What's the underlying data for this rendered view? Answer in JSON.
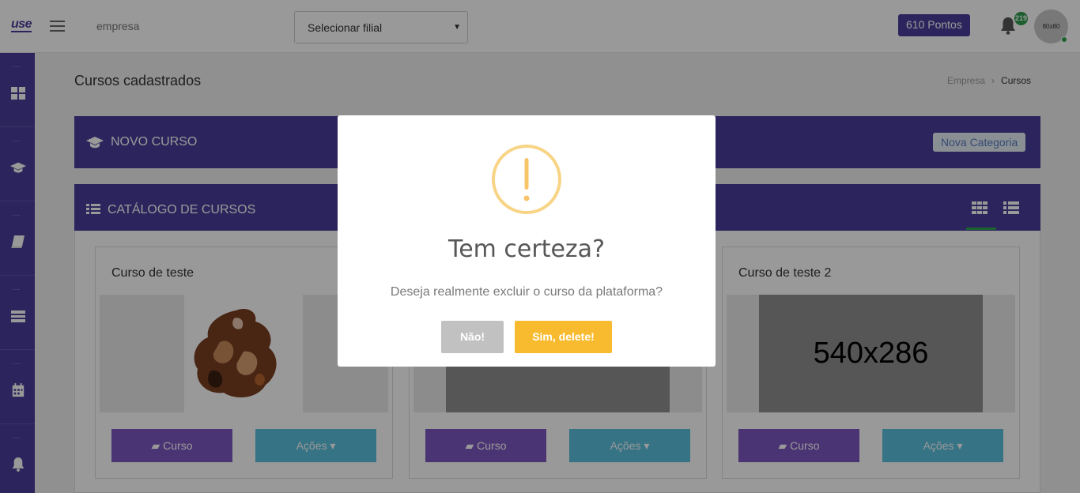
{
  "header": {
    "logo": "use",
    "company": "empresa",
    "branch_select": "Selecionar filial",
    "points": "610 Pontos",
    "notification_count": "219",
    "avatar_label": "80x80"
  },
  "sidebar": {
    "items": [
      {
        "dots": "...",
        "icon": "dashboard-icon"
      },
      {
        "dots": "...",
        "icon": "graduation-cap-icon"
      },
      {
        "dots": "...",
        "icon": "book-icon"
      },
      {
        "dots": "...",
        "icon": "tasks-icon"
      },
      {
        "dots": "...",
        "icon": "calendar-icon"
      },
      {
        "dots": "...",
        "icon": "bell-icon"
      }
    ]
  },
  "page": {
    "title": "Cursos cadastrados",
    "breadcrumb": [
      "Empresa",
      "Cursos"
    ]
  },
  "panels": {
    "new_course": "NOVO CURSO",
    "new_category": "Nova Categoria",
    "catalog": "CATÁLOGO DE CURSOS"
  },
  "cards": [
    {
      "title": "Curso de teste",
      "curso_label": "Curso",
      "acoes_label": "Ações"
    },
    {
      "title": "",
      "curso_label": "Curso",
      "acoes_label": "Ações"
    },
    {
      "title": "Curso de teste 2",
      "image_placeholder": "540x286",
      "curso_label": "Curso",
      "acoes_label": "Ações"
    }
  ],
  "modal": {
    "title": "Tem certeza?",
    "text": "Deseja realmente excluir o curso da plataforma?",
    "cancel": "Não!",
    "confirm": "Sim, delete!"
  },
  "colors": {
    "primary": "#4a3f9c",
    "curso_button": "#7e57c2",
    "acoes_button": "#5bc0de",
    "warning": "#f8bb2f",
    "cancel": "#c1c1c1"
  }
}
